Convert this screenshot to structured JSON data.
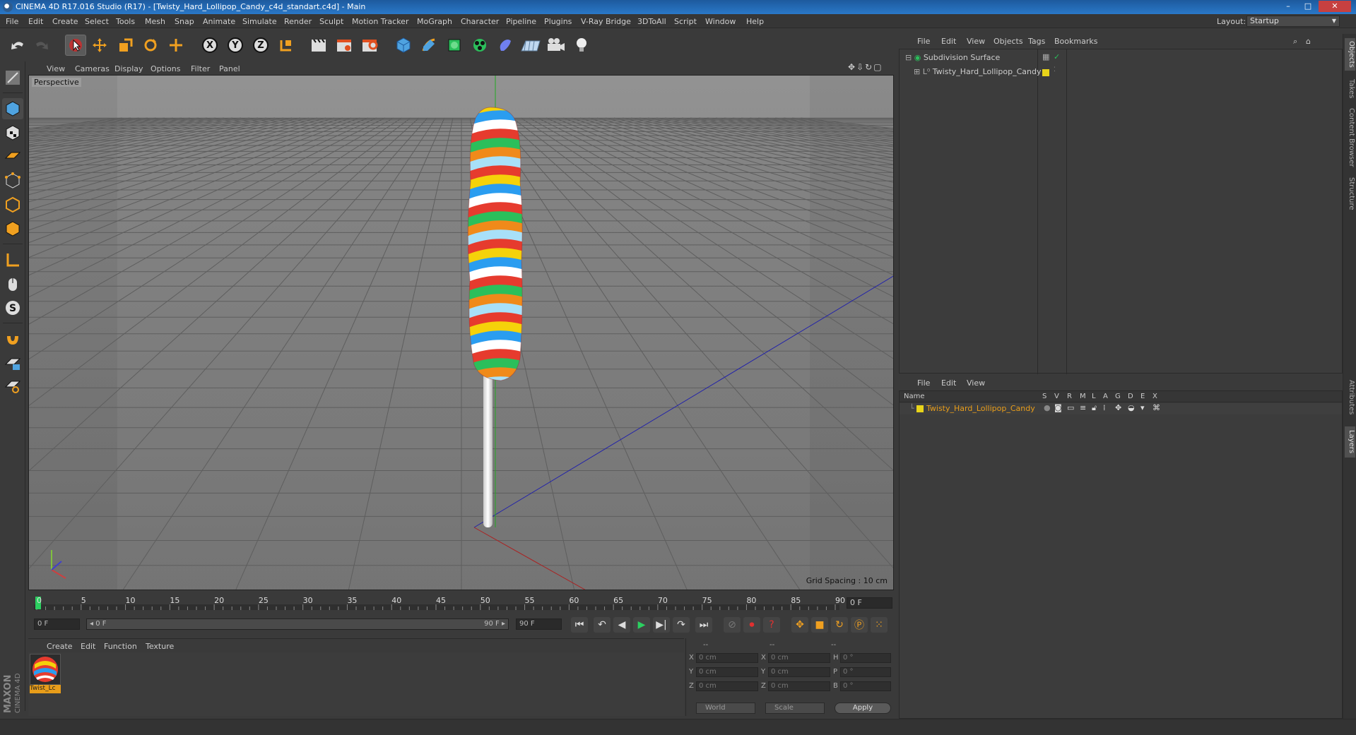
{
  "window": {
    "title": "CINEMA 4D R17.016 Studio (R17) - [Twisty_Hard_Lollipop_Candy_c4d_standart.c4d] - Main",
    "minimize": "–",
    "maximize": "□",
    "close": "✕"
  },
  "menubar": {
    "items": [
      "File",
      "Edit",
      "Create",
      "Select",
      "Tools",
      "Mesh",
      "Snap",
      "Animate",
      "Simulate",
      "Render",
      "Sculpt",
      "Motion Tracker",
      "MoGraph",
      "Character",
      "Pipeline",
      "Plugins",
      "V-Ray Bridge",
      "3DToAll",
      "Script",
      "Window",
      "Help"
    ],
    "layout_label": "Layout:",
    "layout_value": "Startup"
  },
  "toolbar": {
    "axis_x": "X",
    "axis_y": "Y",
    "axis_z": "Z"
  },
  "viewport": {
    "menu": [
      "View",
      "Cameras",
      "Display",
      "Options",
      "Filter",
      "Panel"
    ],
    "label": "Perspective",
    "grid_spacing": "Grid Spacing : 10 cm"
  },
  "timeline": {
    "ticks": [
      "0",
      "5",
      "10",
      "15",
      "20",
      "25",
      "30",
      "35",
      "40",
      "45",
      "50",
      "55",
      "60",
      "65",
      "70",
      "75",
      "80",
      "85",
      "90"
    ],
    "current_frame": "0 F",
    "start_field": "0 F",
    "range_start": "◂ 0 F",
    "range_end": "90 F ▸",
    "end_field": "90 F"
  },
  "material_manager": {
    "menu": [
      "Create",
      "Edit",
      "Function",
      "Texture"
    ],
    "material_name": "Twist_Lc"
  },
  "branding": {
    "maxon": "MAXON",
    "c4d": "CINEMA 4D"
  },
  "coordinates": {
    "headers": [
      "--",
      "--",
      "--"
    ],
    "rows": [
      {
        "a": "X",
        "av": "0 cm",
        "b": "X",
        "bv": "0 cm",
        "c": "H",
        "cv": "0 °"
      },
      {
        "a": "Y",
        "av": "0 cm",
        "b": "Y",
        "bv": "0 cm",
        "c": "P",
        "cv": "0 °"
      },
      {
        "a": "Z",
        "av": "0 cm",
        "b": "Z",
        "bv": "0 cm",
        "c": "B",
        "cv": "0 °"
      }
    ],
    "world": "World",
    "scale": "Scale",
    "apply": "Apply"
  },
  "object_manager": {
    "menu": [
      "File",
      "Edit",
      "View",
      "Objects",
      "Tags",
      "Bookmarks"
    ],
    "objects": [
      "Subdivision Surface",
      "Twisty_Hard_Lollipop_Candy"
    ]
  },
  "layer_manager": {
    "menu": [
      "File",
      "Edit",
      "View"
    ],
    "columns": [
      "Name",
      "S",
      "V",
      "R",
      "M",
      "L",
      "A",
      "G",
      "D",
      "E",
      "X"
    ],
    "layer_name": "Twisty_Hard_Lollipop_Candy"
  },
  "side_tabs": [
    "Objects",
    "Takes",
    "Content Browser",
    "Structure",
    "Attributes",
    "Layers"
  ],
  "colors": {
    "accent": "#e89d1a",
    "layer_yellow": "#e8d41a",
    "title_blue": "#2a78c8"
  }
}
